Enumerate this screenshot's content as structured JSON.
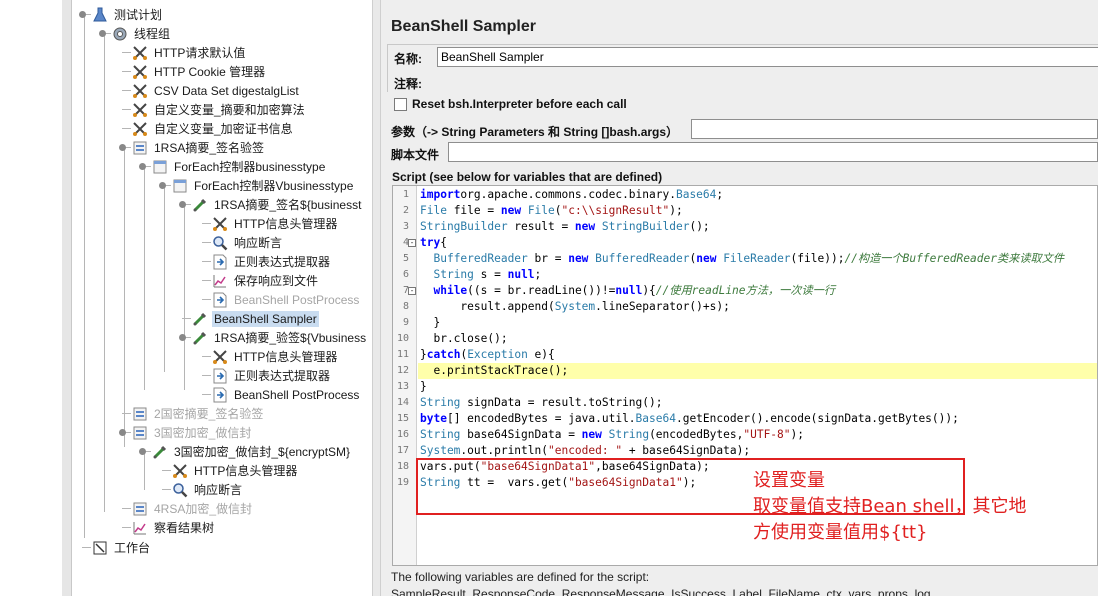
{
  "tree": {
    "items": [
      {
        "label": "测试计划",
        "icon": "test-plan-icon",
        "state": "normal"
      },
      {
        "label": "线程组",
        "icon": "thread-group-gear-icon",
        "state": "normal"
      },
      {
        "label": "HTTP请求默认值",
        "icon": "config-scissors-icon",
        "state": "normal"
      },
      {
        "label": "HTTP Cookie 管理器",
        "icon": "config-scissors-icon",
        "state": "normal"
      },
      {
        "label": "CSV Data Set digestalgList",
        "icon": "config-scissors-icon",
        "state": "normal"
      },
      {
        "label": "自定义变量_摘要和加密算法",
        "icon": "config-scissors-icon",
        "state": "normal"
      },
      {
        "label": "自定义变量_加密证书信息",
        "icon": "config-scissors-icon",
        "state": "normal"
      },
      {
        "label": "1RSA摘要_签名验签",
        "icon": "simple-controller-icon",
        "state": "normal"
      },
      {
        "label": "ForEach控制器businesstype",
        "icon": "foreach-controller-icon",
        "state": "normal"
      },
      {
        "label": "ForEach控制器Vbusinesstype",
        "icon": "foreach-controller-icon",
        "state": "normal"
      },
      {
        "label": "1RSA摘要_签名${businesst",
        "icon": "sampler-pipette-icon",
        "state": "normal"
      },
      {
        "label": "HTTP信息头管理器",
        "icon": "config-scissors-icon",
        "state": "normal"
      },
      {
        "label": "响应断言",
        "icon": "assertion-magnifier-icon",
        "state": "normal"
      },
      {
        "label": "正则表达式提取器",
        "icon": "post-processor-icon",
        "state": "normal"
      },
      {
        "label": "保存响应到文件",
        "icon": "listener-chart-icon",
        "state": "normal"
      },
      {
        "label": "BeanShell PostProcess",
        "icon": "post-processor-icon",
        "state": "disabled"
      },
      {
        "label": "BeanShell Sampler",
        "icon": "sampler-pipette-icon",
        "state": "selected"
      },
      {
        "label": "1RSA摘要_验签${Vbusiness",
        "icon": "sampler-pipette-icon",
        "state": "normal"
      },
      {
        "label": "HTTP信息头管理器",
        "icon": "config-scissors-icon",
        "state": "normal"
      },
      {
        "label": "正则表达式提取器",
        "icon": "post-processor-icon",
        "state": "normal"
      },
      {
        "label": "BeanShell PostProcess",
        "icon": "post-processor-icon",
        "state": "normal"
      },
      {
        "label": "2国密摘要_签名验签",
        "icon": "simple-controller-icon",
        "state": "disabled"
      },
      {
        "label": "3国密加密_做信封",
        "icon": "simple-controller-icon",
        "state": "disabled"
      },
      {
        "label": "3国密加密_做信封_${encryptSM}",
        "icon": "sampler-pipette-icon",
        "state": "normal"
      },
      {
        "label": "HTTP信息头管理器",
        "icon": "config-scissors-icon",
        "state": "normal"
      },
      {
        "label": "响应断言",
        "icon": "assertion-magnifier-icon",
        "state": "normal"
      },
      {
        "label": "4RSA加密_做信封",
        "icon": "simple-controller-icon",
        "state": "disabled"
      },
      {
        "label": "察看结果树",
        "icon": "listener-chart-icon",
        "state": "normal"
      },
      {
        "label": "工作台",
        "icon": "workbench-icon",
        "state": "normal"
      }
    ]
  },
  "panel": {
    "title": "BeanShell Sampler",
    "name_label": "名称:",
    "name_value": "BeanShell Sampler",
    "comment_label": "注释:",
    "reset_label": "Reset bsh.Interpreter before each call",
    "params_label": "参数（-> String Parameters 和 String []bash.args）",
    "file_label": "脚本文件",
    "script_label": "Script (see below for variables that are defined)",
    "footer_note": "The following variables are defined for the script:",
    "footer_vars": "SampleResult, ResponseCode, ResponseMessage, IsSuccess, Label, FileName, ctx, vars, props, log"
  },
  "code": {
    "highlighted_line": 12,
    "lines": [
      [
        [
          "kw",
          "import"
        ],
        [
          "",
          "org.apache.commons.codec.binary."
        ],
        [
          "cl",
          "Base64"
        ],
        [
          "",
          ";"
        ]
      ],
      [
        [
          "ty",
          "File"
        ],
        [
          "",
          " file = "
        ],
        [
          "kw",
          "new"
        ],
        [
          "",
          " "
        ],
        [
          "ty",
          "File"
        ],
        [
          "",
          "("
        ],
        [
          "st",
          "\"c:\\\\signResult\""
        ],
        [
          "",
          ");"
        ]
      ],
      [
        [
          "ty",
          "StringBuilder"
        ],
        [
          "",
          " result = "
        ],
        [
          "kw",
          "new"
        ],
        [
          "",
          " "
        ],
        [
          "ty",
          "StringBuilder"
        ],
        [
          "",
          "();"
        ]
      ],
      [
        [
          "kw",
          "try"
        ],
        [
          "",
          "{"
        ]
      ],
      [
        [
          "",
          "  "
        ],
        [
          "ty",
          "BufferedReader"
        ],
        [
          "",
          " br = "
        ],
        [
          "kw",
          "new"
        ],
        [
          "",
          " "
        ],
        [
          "ty",
          "BufferedReader"
        ],
        [
          "",
          "("
        ],
        [
          "kw",
          "new"
        ],
        [
          "",
          " "
        ],
        [
          "ty",
          "FileReader"
        ],
        [
          "",
          "(file));"
        ],
        [
          "cm",
          "//构造一个BufferedReader类来读取文件"
        ]
      ],
      [
        [
          "",
          "  "
        ],
        [
          "ty",
          "String"
        ],
        [
          "",
          " s = "
        ],
        [
          "kw",
          "null"
        ],
        [
          "",
          ";"
        ]
      ],
      [
        [
          "",
          "  "
        ],
        [
          "kw",
          "while"
        ],
        [
          "",
          "((s = br.readLine())!="
        ],
        [
          "kw",
          "null"
        ],
        [
          "",
          "){"
        ],
        [
          "cm",
          "//使用readLine方法，一次读一行"
        ]
      ],
      [
        [
          "",
          "      result.append("
        ],
        [
          "ty",
          "System"
        ],
        [
          "",
          ".lineSeparator()+s);"
        ]
      ],
      [
        [
          "",
          "  }"
        ]
      ],
      [
        [
          "",
          "  br.close();"
        ]
      ],
      [
        [
          "",
          "}"
        ],
        [
          "kw",
          "catch"
        ],
        [
          "",
          "("
        ],
        [
          "ty",
          "Exception"
        ],
        [
          "",
          " e){"
        ]
      ],
      [
        [
          "",
          "  e.printStackTrace();"
        ]
      ],
      [
        [
          "",
          "}"
        ]
      ],
      [
        [
          "ty",
          "String"
        ],
        [
          "",
          " signData = result.toString();"
        ]
      ],
      [
        [
          "kw",
          "byte"
        ],
        [
          "",
          "[] encodedBytes = java.util."
        ],
        [
          "cl",
          "Base64"
        ],
        [
          "",
          ".getEncoder().encode(signData.getBytes());"
        ]
      ],
      [
        [
          "ty",
          "String"
        ],
        [
          "",
          " base64SignData = "
        ],
        [
          "kw",
          "new"
        ],
        [
          "",
          " "
        ],
        [
          "ty",
          "String"
        ],
        [
          "",
          "(encodedBytes,"
        ],
        [
          "st",
          "\"UTF-8\""
        ],
        [
          "",
          ");"
        ]
      ],
      [
        [
          "ty",
          "System"
        ],
        [
          "",
          ".out.println("
        ],
        [
          "st",
          "\"encoded: \""
        ],
        [
          "",
          " + base64SignData);"
        ]
      ],
      [
        [
          "",
          "vars.put("
        ],
        [
          "st",
          "\"base64SignData1\""
        ],
        [
          "",
          ",base64SignData);"
        ]
      ],
      [
        [
          "ty",
          "String"
        ],
        [
          "",
          " tt =  vars.get("
        ],
        [
          "st",
          "\"base64SignData1\""
        ],
        [
          "",
          ");"
        ]
      ]
    ]
  },
  "annotation": {
    "line1": "设置变量",
    "line2": "取变量值支持Bean shell，其它地",
    "line3": "方使用变量值用${tt}"
  }
}
